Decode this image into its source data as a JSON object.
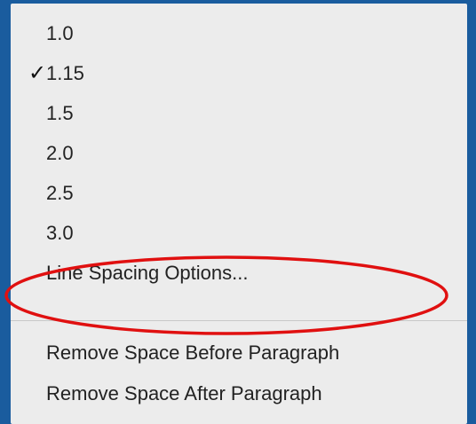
{
  "menu": {
    "items": [
      {
        "label": "1.0",
        "checked": false
      },
      {
        "label": "1.15",
        "checked": true
      },
      {
        "label": "1.5",
        "checked": false
      },
      {
        "label": "2.0",
        "checked": false
      },
      {
        "label": "2.5",
        "checked": false
      },
      {
        "label": "3.0",
        "checked": false
      },
      {
        "label": "Line Spacing Options...",
        "checked": false
      }
    ],
    "check_glyph": "✓",
    "after_divider": [
      {
        "label": "Remove Space Before Paragraph"
      },
      {
        "label": "Remove Space After Paragraph"
      }
    ]
  },
  "colors": {
    "background": "#1a5c9e",
    "menu": "#ececec",
    "highlight": "#e01010"
  },
  "icons": {
    "check": "checkmark-icon"
  }
}
